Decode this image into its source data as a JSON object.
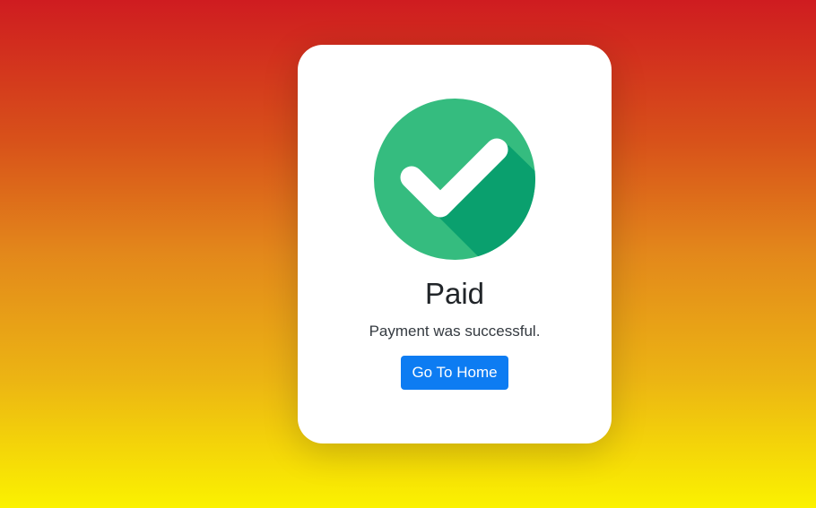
{
  "colors": {
    "background_top": "#cf1c20",
    "background_bottom": "#fbf200",
    "card": "#ffffff",
    "check_light": "#35bc7f",
    "check_dark": "#0aa06e",
    "button": "#0d7cf2"
  },
  "status": {
    "icon": "check-circle-icon",
    "title": "Paid",
    "message": "Payment was successful."
  },
  "actions": {
    "home_label": "Go To Home"
  }
}
